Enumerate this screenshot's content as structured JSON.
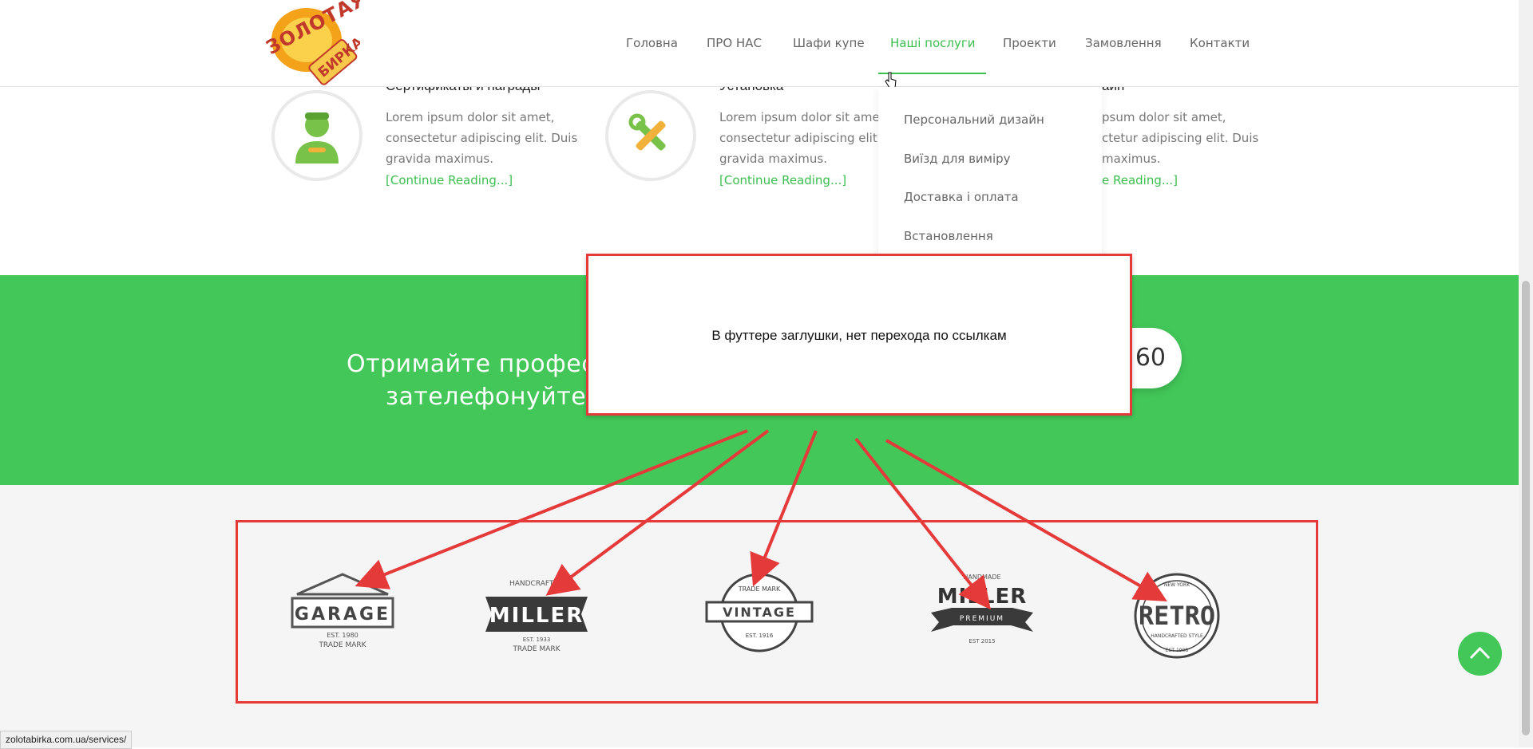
{
  "header": {
    "logo_alt": "Золотая бирка",
    "nav": [
      {
        "label": "Головна",
        "active": false
      },
      {
        "label": "ПРО НАС",
        "active": false
      },
      {
        "label": "Шафи купе",
        "active": false
      },
      {
        "label": "Наші послуги",
        "active": true
      },
      {
        "label": "Проекти",
        "active": false
      },
      {
        "label": "Замовлення",
        "active": false
      },
      {
        "label": "Контакти",
        "active": false
      }
    ]
  },
  "dropdown": {
    "items": [
      "Персональний дизайн",
      "Виїзд для виміру",
      "Доставка і оплата",
      "Встановлення"
    ]
  },
  "features": [
    {
      "title": "Сертификаты и награды",
      "text_lines": [
        "Lorem ipsum dolor sit amet,",
        "consectetur adipiscing elit. Duis",
        "gravida maximus."
      ],
      "link": "[Continue Reading...]",
      "icon": "worker-icon"
    },
    {
      "title": "Установка",
      "text_lines": [
        "Lorem ipsum dolor sit amet,",
        "consectetur adipiscing elit. Duis",
        "gravida maximus."
      ],
      "link": "[Continue Reading...]",
      "icon": "tools-icon"
    },
    {
      "title": "айн",
      "text_lines": [
        "psum dolor sit amet,",
        "ctetur adipiscing elit. Duis",
        "maximus."
      ],
      "link": "e Reading...]",
      "icon": ""
    }
  ],
  "cta": {
    "line1": "Отримайте профес",
    "line2": "зателефонуйте",
    "phone_tail": "60"
  },
  "annotation": {
    "text": "В футтере заглушки, нет перехода по ссылкам"
  },
  "clients": [
    {
      "name": "GARAGE",
      "sub": "TRADE MARK",
      "est": "EST. 1980"
    },
    {
      "name": "MILLER",
      "sub": "TRADE MARK",
      "top": "HANDCRAFTED",
      "est": "EST. 1933"
    },
    {
      "name": "VINTAGE",
      "sub": "EST. 1916",
      "top": "TRADE MARK"
    },
    {
      "name": "MILLER",
      "sub": "PREMIUM",
      "top": "HANDMADE",
      "est": "EST 2015"
    },
    {
      "name": "RETRO",
      "sub": "HANDCRAFTED STYLE",
      "top": "NEW YORK",
      "est": "EST 1908"
    }
  ],
  "status_url": "zolotabirka.com.ua/services/",
  "colors": {
    "accent": "#43c759",
    "annotation": "#e53a3a"
  }
}
